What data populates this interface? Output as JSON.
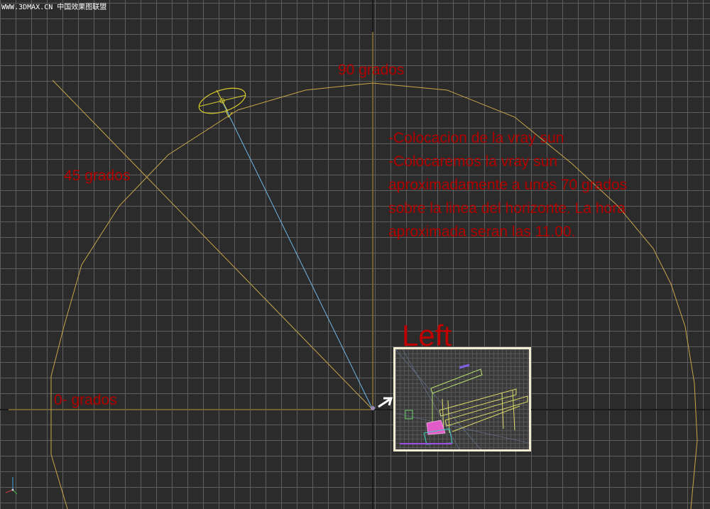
{
  "watermark": "WWW.3DMAX.CN 中国效果图联盟",
  "labels": {
    "deg90": "90 grados",
    "deg45": "45 grados",
    "deg0": "0- grados"
  },
  "note": {
    "lines": [
      "-Colocacion de la vray sun",
      "-Colocaremos la vray sun",
      "aproximadamente a unos 70 grados",
      "sobre la linea del horizonte. La hora",
      "aproximada seran las 11.00."
    ]
  },
  "inset": {
    "view_label": "Left"
  },
  "colors": {
    "grid": "#5e5e5e",
    "background": "#2b2b2b",
    "arc": "#c7a54a",
    "sun_ray": "#6fb6e6",
    "annotation_text": "#b00000",
    "inset_border": "#f2ecd2"
  },
  "icons": {
    "sun": "vray-sun-icon",
    "pointer": "arrow-icon",
    "axis": "axis-tripod-icon"
  }
}
